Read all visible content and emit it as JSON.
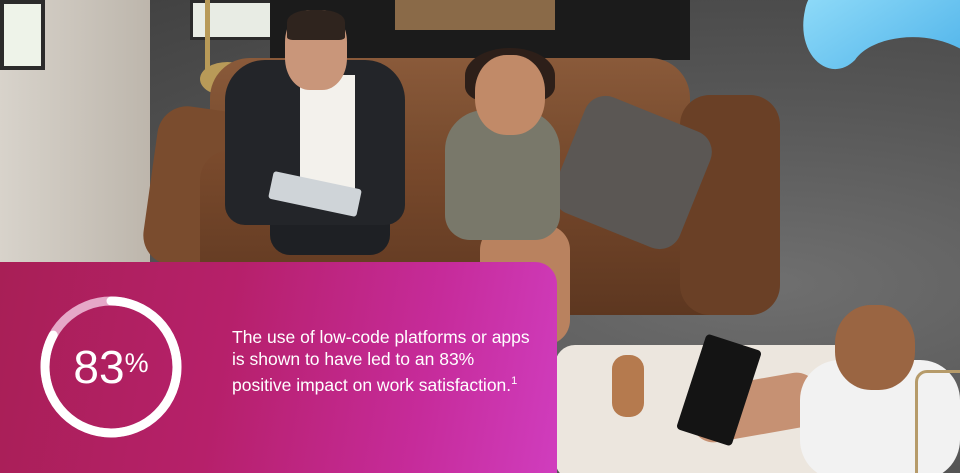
{
  "stat": {
    "value": 83,
    "percent_symbol": "%",
    "number_text": "83",
    "description": "The use of low-code platforms or apps is shown to have led to an 83% positive impact on work satisfaction.",
    "footnote": "1"
  },
  "colors": {
    "card_start": "#a81f56",
    "card_end": "#d03dbe",
    "ring": "#ffffff",
    "ring_track": "#e6a8c8",
    "swirl": "#5fc4ef"
  },
  "icons": {
    "gauge": "progress-ring-icon"
  }
}
